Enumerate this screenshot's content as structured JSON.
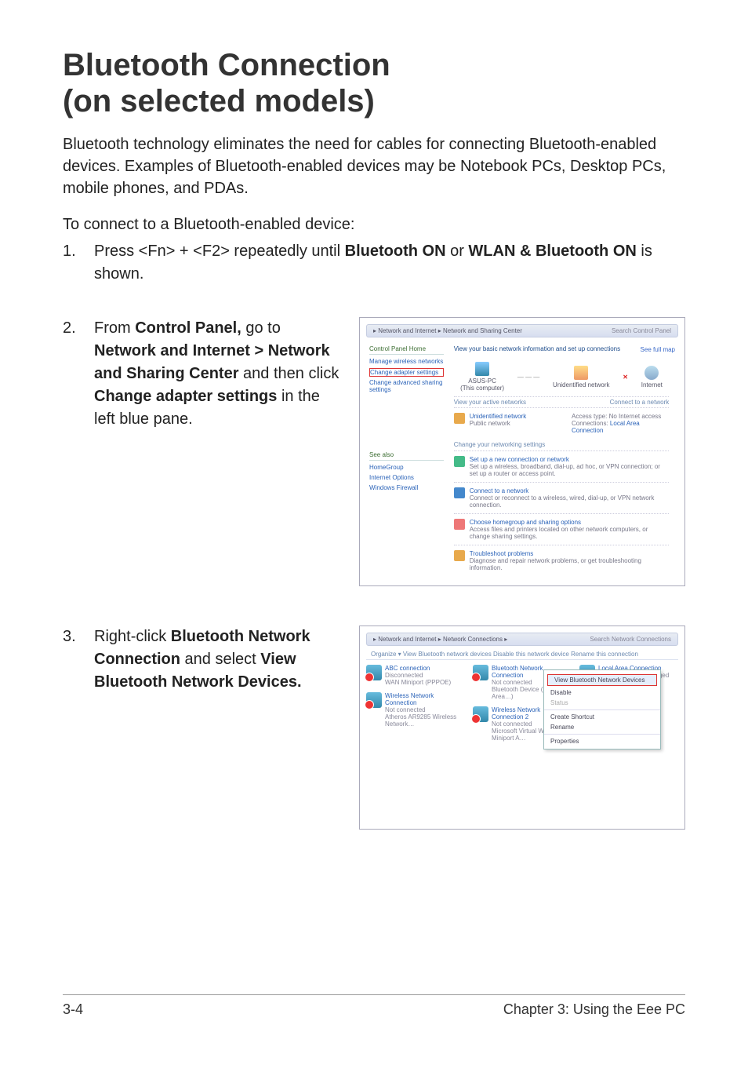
{
  "heading_line1": "Bluetooth Connection",
  "heading_line2": "(on selected models)",
  "intro": "Bluetooth technology eliminates the need for cables for connecting Bluetooth-enabled devices. Examples of Bluetooth-enabled devices may be Notebook PCs, Desktop PCs, mobile phones, and PDAs.",
  "connect_heading": "To connect to a Bluetooth-enabled device:",
  "step1": {
    "num": "1.",
    "pre": "Press <Fn> + <F2> repeatedly until ",
    "bold1": "Bluetooth ON",
    "mid": " or ",
    "bold2": "WLAN & Bluetooth ON",
    "post": " is shown."
  },
  "step2": {
    "num": "2.",
    "pre": "From ",
    "b1": "Control Panel,",
    "t1": " go to ",
    "b2": "Network and Internet > Network and Sharing Center",
    "t2": " and then click ",
    "b3": "Change adapter settings",
    "post": " in the left blue pane."
  },
  "step3": {
    "num": "3.",
    "pre": "Right-click ",
    "b1": "Bluetooth Network Connection",
    "t1": " and select ",
    "b2": "View Bluetooth Network Devices.",
    "post": ""
  },
  "shot1": {
    "breadcrumb": "▸ Network and Internet ▸ Network and Sharing Center",
    "search": "Search Control Panel",
    "sidebar_header": "Control Panel Home",
    "sidebar_links": {
      "l1": "Manage wireless networks",
      "l2": "Change adapter settings",
      "l3": "Change advanced sharing settings"
    },
    "see_full": "See full map",
    "main_title": "View your basic network information and set up connections",
    "node1": "ASUS-PC",
    "node1_sub": "(This computer)",
    "node2": "Unidentified network",
    "node3": "Internet",
    "view_active": "View your active networks",
    "connect_label": "Connect to a network",
    "active_name": "Unidentified network",
    "active_type": "Public network",
    "access_label": "Access type:",
    "access_val": "No Internet access",
    "conn_label": "Connections:",
    "conn_val": "Local Area Connection",
    "change_hdr": "Change your networking settings",
    "sec1_h": "Set up a new connection or network",
    "sec1_d": "Set up a wireless, broadband, dial-up, ad hoc, or VPN connection; or set up a router or access point.",
    "sec2_h": "Connect to a network",
    "sec2_d": "Connect or reconnect to a wireless, wired, dial-up, or VPN network connection.",
    "sec3_h": "Choose homegroup and sharing options",
    "sec3_d": "Access files and printers located on other network computers, or change sharing settings.",
    "sec4_h": "Troubleshoot problems",
    "sec4_d": "Diagnose and repair network problems, or get troubleshooting information.",
    "seealso": "See also",
    "sa1": "HomeGroup",
    "sa2": "Internet Options",
    "sa3": "Windows Firewall"
  },
  "shot2": {
    "breadcrumb": "▸ Network and Internet ▸ Network Connections ▸",
    "search": "Search Network Connections",
    "menu": "Organize ▾    View Bluetooth network devices    Disable this network device    Rename this connection",
    "c1_h": "ABC connection",
    "c1_d": "Disconnected",
    "c1_d2": "WAN Miniport (PPPOE)",
    "c2_h": "Bluetooth Network Connection",
    "c2_d": "Not connected",
    "c2_d2": "Bluetooth Device (Personal Area…)",
    "c3_h": "Local Area Connection",
    "c3_d": "Network cable unplugged",
    "c4_h": "Wireless Network Connection",
    "c4_d": "Not connected",
    "c4_d2": "Atheros AR9285 Wireless Network…",
    "c5_h": "Wireless Network Connection 2",
    "c5_d": "Not connected",
    "c5_d2": "Microsoft Virtual WiFi Miniport A…",
    "ctx_hl": "View Bluetooth Network Devices",
    "ctx_items": {
      "i1": "Disable",
      "i2": "Status",
      "i3": "Create Shortcut",
      "i4": "Rename",
      "i5": "Properties"
    }
  },
  "footer_left": "3-4",
  "footer_right": "Chapter 3: Using the Eee PC"
}
